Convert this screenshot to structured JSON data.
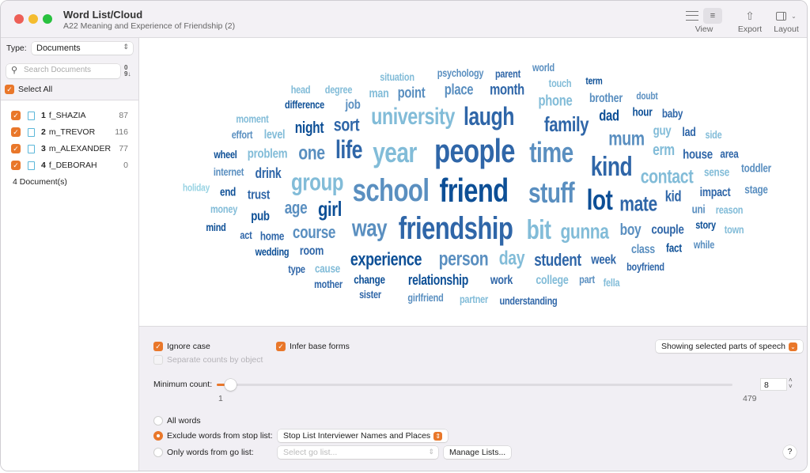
{
  "window": {
    "title": "Word List/Cloud",
    "subtitle": "A22 Meaning and Experience of Friendship (2)"
  },
  "toolbar": {
    "view_label": "View",
    "export_label": "Export",
    "layout_label": "Layout"
  },
  "sidebar": {
    "type_label": "Type:",
    "type_value": "Documents",
    "search_placeholder": "Search Documents",
    "select_all": "Select All",
    "documents": [
      {
        "num": "1",
        "name": "f_SHAZIA",
        "count": "87",
        "checked": true
      },
      {
        "num": "2",
        "name": "m_TREVOR",
        "count": "116",
        "checked": true
      },
      {
        "num": "3",
        "name": "m_ALEXANDER",
        "count": "77",
        "checked": true
      },
      {
        "num": "4",
        "name": "f_DEBORAH",
        "count": "0",
        "checked": true
      }
    ],
    "doc_count": "4 Document(s)"
  },
  "colors": {
    "accent": "#e9772a",
    "shade1": "#0d4f96",
    "shade2": "#2f66a8",
    "shade3": "#5a8fc0",
    "shade4": "#82bcd8",
    "shade5": "#98d3e3"
  },
  "cloud": {
    "words": [
      "situation",
      "psychology",
      "parent",
      "world",
      "head",
      "degree",
      "man",
      "point",
      "place",
      "month",
      "touch",
      "term",
      "difference",
      "job",
      "university",
      "laugh",
      "phone",
      "brother",
      "doubt",
      "moment",
      "night",
      "sort",
      "family",
      "dad",
      "hour",
      "baby",
      "effort",
      "level",
      "guy",
      "lad",
      "side",
      "wheel",
      "problem",
      "one",
      "life",
      "year",
      "people",
      "time",
      "mum",
      "erm",
      "house",
      "area",
      "kind",
      "internet",
      "drink",
      "group",
      "contact",
      "sense",
      "toddler",
      "holiday",
      "end",
      "trust",
      "school",
      "friend",
      "stuff",
      "lot",
      "mate",
      "kid",
      "impact",
      "stage",
      "money",
      "pub",
      "age",
      "girl",
      "uni",
      "reason",
      "mind",
      "act",
      "home",
      "course",
      "way",
      "friendship",
      "bit",
      "gunna",
      "boy",
      "couple",
      "story",
      "town",
      "wedding",
      "room",
      "experience",
      "person",
      "day",
      "student",
      "week",
      "class",
      "fact",
      "while",
      "type",
      "cause",
      "boyfriend",
      "mother",
      "change",
      "relationship",
      "work",
      "college",
      "part",
      "fella",
      "sister",
      "girlfriend",
      "partner",
      "understanding"
    ]
  },
  "options": {
    "ignore_case": "Ignore case",
    "ignore_case_checked": true,
    "infer_base": "Infer base forms",
    "infer_base_checked": true,
    "separate_counts": "Separate counts by object",
    "separate_counts_enabled": false,
    "pos_filter": "Showing selected parts of speech",
    "min_count_label": "Minimum count:",
    "min_count_value": "8",
    "slider_min": "1",
    "slider_max": "479",
    "all_words": "All words",
    "exclude_stop": "Exclude words from stop list:",
    "stop_list_value": "Stop List Interviewer Names and Places",
    "only_go": "Only words from go list:",
    "go_list_placeholder": "Select go list...",
    "manage_lists": "Manage Lists...",
    "selected_radio": "exclude_stop",
    "help": "?"
  }
}
